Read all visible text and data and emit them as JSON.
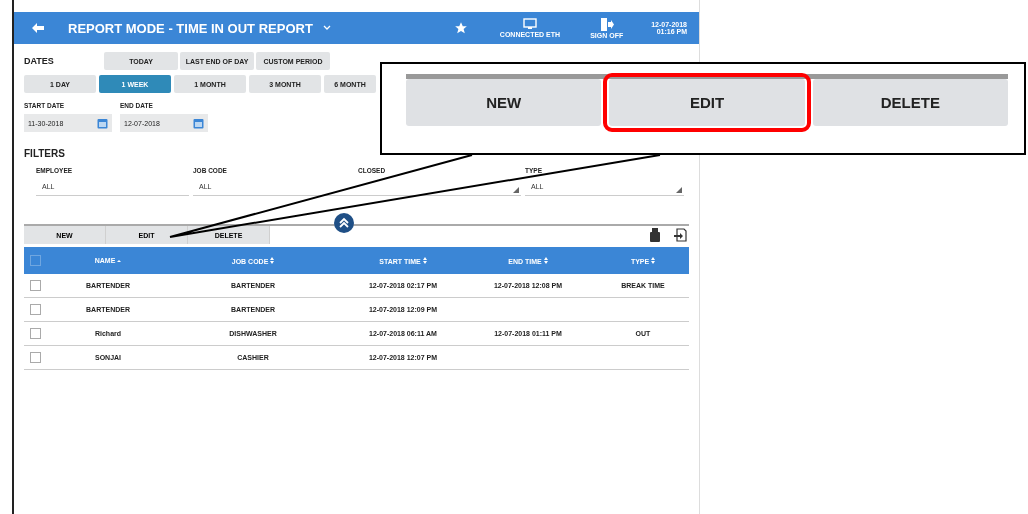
{
  "header": {
    "title": "REPORT MODE - TIME IN OUT REPORT",
    "connection_label": "CONNECTED ETH",
    "signoff_label": "SIGN OFF",
    "date": "12-07-2018",
    "time": "01:16 PM"
  },
  "dates": {
    "label": "DATES",
    "quick": [
      "TODAY",
      "LAST END OF DAY",
      "CUSTOM PERIOD"
    ],
    "periods": [
      {
        "label": "1 DAY",
        "selected": false
      },
      {
        "label": "1 WEEK",
        "selected": true
      },
      {
        "label": "1 MONTH",
        "selected": false
      },
      {
        "label": "3 MONTH",
        "selected": false
      },
      {
        "label": "6 MONTH",
        "selected": false
      }
    ],
    "start_label": "START DATE",
    "start_value": "11-30-2018",
    "end_label": "END DATE",
    "end_value": "12-07-2018"
  },
  "filters": {
    "label": "FILTERS",
    "fields": [
      {
        "label": "EMPLOYEE",
        "value": "ALL",
        "dropdown": false
      },
      {
        "label": "JOB CODE",
        "value": "ALL",
        "dropdown": true
      },
      {
        "label": "CLOSED"
      },
      {
        "label": "TYPE",
        "value": "ALL",
        "dropdown": true
      }
    ]
  },
  "toolbar": {
    "buttons": [
      "NEW",
      "EDIT",
      "DELETE"
    ]
  },
  "table": {
    "all_checked": false,
    "columns": [
      {
        "label": "NAME",
        "sorted": true
      },
      {
        "label": "JOB CODE",
        "sorted": false
      },
      {
        "label": "START TIME",
        "sorted": false
      },
      {
        "label": "END TIME",
        "sorted": false
      },
      {
        "label": "TYPE",
        "sorted": false
      }
    ],
    "rows": [
      {
        "checked": false,
        "cells": [
          "BARTENDER",
          "BARTENDER",
          "12-07-2018 02:17 PM",
          "12-07-2018 12:08 PM",
          "BREAK TIME"
        ]
      },
      {
        "checked": false,
        "cells": [
          "BARTENDER",
          "BARTENDER",
          "12-07-2018 12:09 PM",
          null,
          null
        ]
      },
      {
        "checked": false,
        "cells": [
          "Richard",
          "DISHWASHER",
          "12-07-2018 06:11 AM",
          "12-07-2018 01:11 PM",
          "OUT"
        ]
      },
      {
        "checked": false,
        "cells": [
          "SONJAI",
          "CASHIER",
          "12-07-2018 12:07 PM",
          null,
          null
        ]
      }
    ]
  },
  "callout": {
    "buttons": [
      {
        "label": "NEW",
        "selected": false
      },
      {
        "label": "EDIT",
        "selected": true
      },
      {
        "label": "DELETE",
        "selected": false
      }
    ]
  }
}
